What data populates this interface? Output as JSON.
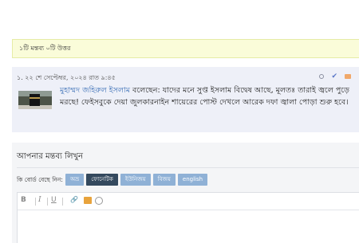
{
  "comment_count": "১টি মন্তব্য ০টি উত্তর",
  "comment": {
    "number": "১.",
    "date": "২২ শে সেপ্টেম্বর, ২০২৪ রাত ৯:৪৫",
    "author": "মুহাম্মদ জহিরুল ইসলাম",
    "text": "বলেছেন: যাদের মনে সুপ্ত ইসলাম বিদ্বেষ আছে, মূলতঃ তারাই জ্বলে পুড়ে মরছে! ফেইসবুকে দেয়া জুলকারনাইন শায়েরের পোস্ট দেখলে আরেক দফা জ্বালা পোড়া শুরু হবে।",
    "icons": [
      "circle-icon",
      "check-icon",
      "flag-icon"
    ]
  },
  "form": {
    "title": "আপনার মন্তব্য লিখুন",
    "keyboard_label": "কি বোর্ড বেছে নিন:",
    "keyboard_options": [
      "অভ্র",
      "ফোনেটিক",
      "ইউনিজয়",
      "বিজয়",
      "english"
    ],
    "keyboard_selected": "ফোনেটিক",
    "toolbar": {
      "bold": "B",
      "italic": "I",
      "underline": "U",
      "link": "🔗"
    }
  },
  "colors": {
    "accent": "#34495e",
    "button": "#8fb1d6",
    "count_bg": "#fafcd9",
    "author": "#3b6fb6"
  }
}
